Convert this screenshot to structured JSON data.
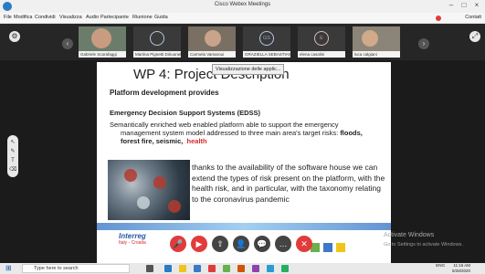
{
  "window": {
    "title": "Cisco Webex Meetings",
    "menu": [
      "File",
      "Modifica",
      "Condividi",
      "Visualizza",
      "Audio",
      "Partecipante",
      "Riunione",
      "Guida"
    ],
    "people_label": "Contatt"
  },
  "participants": [
    {
      "name": "Gabriele Scarafaggi",
      "initials": ""
    },
    {
      "name": "Martina Pignetti Diriuonelli",
      "initials": ""
    },
    {
      "name": "Carmela Vamaroui",
      "initials": ""
    },
    {
      "name": "GRAZIELLA SEBASTIANI",
      "initials": "GS"
    },
    {
      "name": "elena casalini",
      "initials": "E"
    },
    {
      "name": "luca calgiani",
      "initials": ""
    }
  ],
  "slide": {
    "title": "WP 4: Project Description",
    "tooltip": "Visualizzazione delle applic...",
    "subtitle": "Platform development provides",
    "edss_heading": "Emergency Decision Support Systems (EDSS)",
    "para_line1": "Semantically enriched web enabled platform able to support the emergency",
    "para_line2": "management system model addressed to three main area's target risks:",
    "para_risks": "floods,",
    "para_line3": "forest fire, seismic,",
    "para_health": "health",
    "body": "thanks to the availability of the software house we can extend the types of risk present on the platform, with the health risk, and in particular, with the taxonomy relating to the coronavirus pandemic",
    "logo_line1": "Interreg",
    "logo_line2": "Italy - Croatia"
  },
  "watermark": {
    "line1": "Activate Windows",
    "line2": "Go to Settings to activate Windows."
  },
  "taskbar": {
    "search_placeholder": "Type here to search",
    "lang": "ENG",
    "time": "11:16 AM",
    "date": "5/28/2020"
  },
  "colors": {
    "end_call": "#e23b3b",
    "highlight": "#d22a2a",
    "interreg_blue": "#2b5aa6"
  },
  "icons": {
    "controls": [
      "mute-icon",
      "video-icon",
      "share-icon",
      "participants-icon",
      "chat-icon",
      "more-icon",
      "end-call-icon"
    ],
    "sidebar": [
      "pointer-icon",
      "pen-icon",
      "text-icon",
      "eraser-icon"
    ]
  }
}
